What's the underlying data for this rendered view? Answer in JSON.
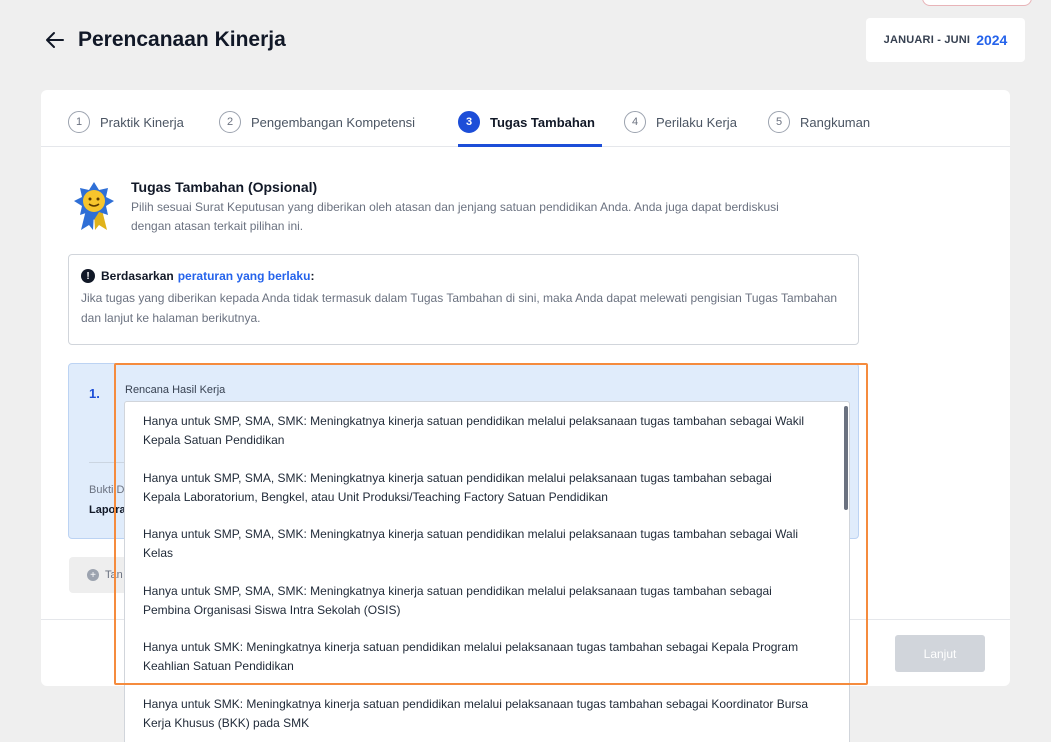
{
  "header": {
    "title": "Perencanaan Kinerja",
    "period_label": "JANUARI - JUNI",
    "period_year": "2024"
  },
  "stepper": {
    "steps": [
      {
        "num": "1",
        "label": "Praktik Kinerja"
      },
      {
        "num": "2",
        "label": "Pengembangan Kompetensi"
      },
      {
        "num": "3",
        "label": "Tugas Tambahan"
      },
      {
        "num": "4",
        "label": "Perilaku Kerja"
      },
      {
        "num": "5",
        "label": "Rangkuman"
      }
    ]
  },
  "intro": {
    "title": "Tugas Tambahan (Opsional)",
    "description": "Pilih sesuai Surat Keputusan yang diberikan oleh atasan dan jenjang satuan pendidikan Anda. Anda juga dapat berdiskusi dengan atasan terkait pilihan ini."
  },
  "notice": {
    "prefix": "Berdasarkan",
    "link": "peraturan yang berlaku",
    "suffix": ":",
    "body": "Jika tugas yang diberikan kepada Anda tidak termasuk dalam Tugas Tambahan di sini, maka Anda dapat melewati pengisian Tugas Tambahan dan lanjut ke halaman berikutnya."
  },
  "item": {
    "number": "1.",
    "rhk_label": "Rencana Hasil Kerja",
    "bukti_label": "Bukti D",
    "lapor_label": "Lapora"
  },
  "add_button": {
    "label": "Tan"
  },
  "next_button": {
    "label": "Lanjut"
  },
  "dropdown": {
    "options": [
      "Hanya untuk SMP, SMA, SMK: Meningkatnya kinerja satuan pendidikan melalui pelaksanaan tugas tambahan sebagai Wakil Kepala Satuan Pendidikan",
      "Hanya untuk SMP, SMA, SMK: Meningkatnya kinerja satuan pendidikan melalui pelaksanaan tugas tambahan sebagai Kepala Laboratorium, Bengkel, atau Unit Produksi/Teaching Factory Satuan Pendidikan",
      "Hanya untuk SMP, SMA, SMK: Meningkatnya kinerja satuan pendidikan melalui pelaksanaan tugas tambahan sebagai Wali Kelas",
      "Hanya untuk SMP, SMA, SMK: Meningkatnya kinerja satuan pendidikan melalui pelaksanaan tugas tambahan sebagai Pembina Organisasi Siswa Intra Sekolah (OSIS)",
      "Hanya untuk SMK: Meningkatnya kinerja satuan pendidikan melalui pelaksanaan tugas tambahan sebagai Kepala Program Keahlian Satuan Pendidikan",
      "Hanya untuk SMK: Meningkatnya kinerja satuan pendidikan melalui pelaksanaan tugas tambahan sebagai Koordinator Bursa Kerja Khusus (BKK) pada SMK"
    ]
  },
  "colors": {
    "primary": "#1d4ed8",
    "link": "#2563eb",
    "highlight": "#f58b3d",
    "item_bg": "#e0ecfb"
  }
}
